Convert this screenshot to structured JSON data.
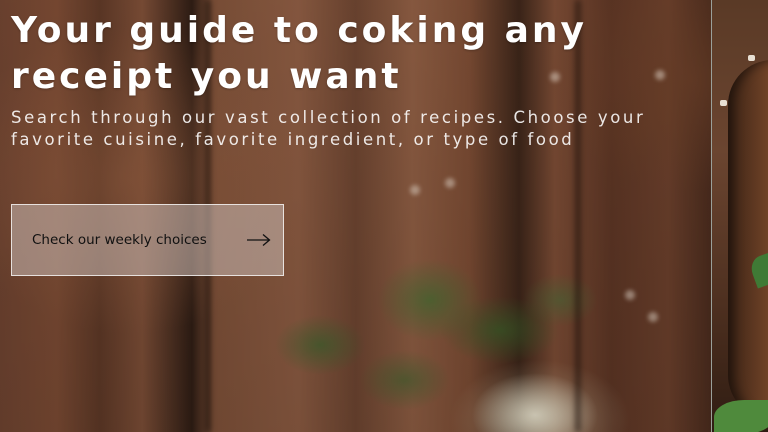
{
  "hero": {
    "title": "Your guide to coking any receipt you want",
    "subtitle": "Search through our vast collection of recipes. Choose your favorite cuisine, favorite ingredient, or type of food",
    "cta_label": "Check our weekly choices",
    "cta_icon": "arrow-right-icon"
  },
  "colors": {
    "title_text": "#ffffff",
    "cta_background": "#c8b9b4",
    "cta_border": "#ffffff",
    "cta_text": "#111111"
  }
}
